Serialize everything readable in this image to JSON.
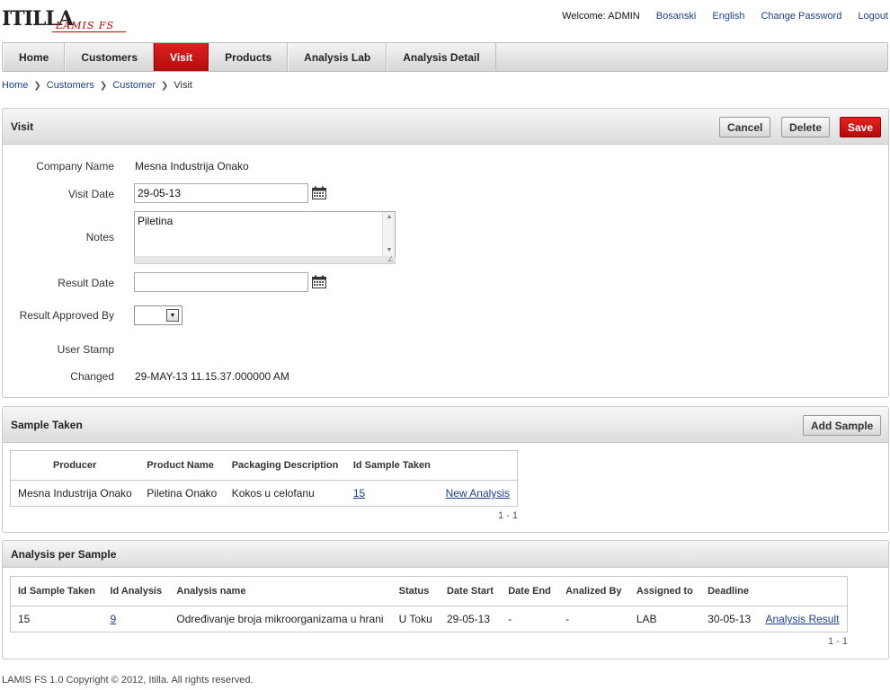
{
  "header": {
    "logo_mark": "ITILLA",
    "logo_sub": "LAMIS FS",
    "welcome": "Welcome: ADMIN",
    "links": [
      "Bosanski",
      "English",
      "Change Password",
      "Logout"
    ]
  },
  "tabs": [
    "Home",
    "Customers",
    "Visit",
    "Products",
    "Analysis Lab",
    "Analysis Detail"
  ],
  "active_tab": "Visit",
  "breadcrumb": [
    "Home",
    "Customers",
    "Customer",
    "Visit"
  ],
  "visit": {
    "title": "Visit",
    "buttons": {
      "cancel": "Cancel",
      "delete": "Delete",
      "save": "Save"
    },
    "fields": {
      "company_name_label": "Company Name",
      "company_name_value": "Mesna Industrija Onako",
      "visit_date_label": "Visit Date",
      "visit_date_value": "29-05-13",
      "notes_label": "Notes",
      "notes_value": "Piletina",
      "result_date_label": "Result Date",
      "result_date_value": "",
      "result_approved_label": "Result Approved By",
      "user_stamp_label": "User Stamp",
      "user_stamp_value": "",
      "changed_label": "Changed",
      "changed_value": "29-MAY-13 11.15.37.000000 AM"
    }
  },
  "samples": {
    "title": "Sample Taken",
    "add_button": "Add Sample",
    "columns": [
      "Producer",
      "Product Name",
      "Packaging Description",
      "Id Sample Taken",
      ""
    ],
    "rows": [
      {
        "producer": "Mesna Industrija Onako",
        "product_name": "Piletina Onako",
        "packaging": "Kokos u celofanu",
        "id_sample": "15",
        "action": "New Analysis"
      }
    ],
    "pager": "1 - 1"
  },
  "analysis": {
    "title": "Analysis per Sample",
    "columns": [
      "Id Sample Taken",
      "Id Analysis",
      "Analysis name",
      "Status",
      "Date Start",
      "Date End",
      "Analized By",
      "Assigned to",
      "Deadline",
      ""
    ],
    "rows": [
      {
        "id_sample": "15",
        "id_analysis": "9",
        "name": "Određivanje broja mikroorganizama u hrani",
        "status": "U Toku",
        "date_start": "29-05-13",
        "date_end": "-",
        "analized_by": "-",
        "assigned_to": "LAB",
        "deadline": "30-05-13",
        "action": "Analysis Result"
      }
    ],
    "pager": "1 - 1"
  },
  "footer": "LAMIS FS 1.0 Copyright © 2012, Itilla. All rights reserved.",
  "colors": {
    "accent_red": "#cc1111",
    "link_blue": "#1c3f8f"
  }
}
